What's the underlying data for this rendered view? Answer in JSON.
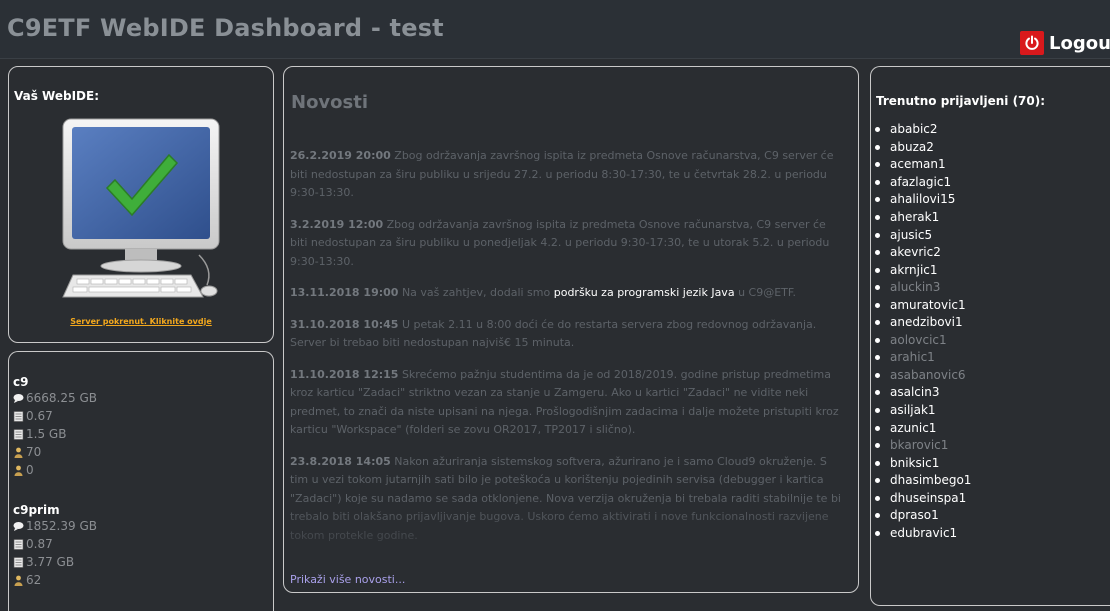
{
  "header": {
    "title": "C9ETF WebIDE Dashboard - test",
    "logout_label": "Logout",
    "logout_icon": "power-icon",
    "accent": "#d9191c"
  },
  "webide": {
    "title": "Vaš WebIDE:",
    "icon": "computer-checkmark-icon",
    "status_link": "Server pokrenut. Kliknite ovdje"
  },
  "servers": [
    {
      "name": "c9",
      "stats": [
        {
          "icon": "disk-icon",
          "value": "6668.25 GB"
        },
        {
          "icon": "cpu-icon",
          "value": "0.67"
        },
        {
          "icon": "memory-icon",
          "value": "1.5 GB"
        },
        {
          "icon": "user-icon",
          "value": "70"
        },
        {
          "icon": "user-icon",
          "value": "0"
        }
      ]
    },
    {
      "name": "c9prim",
      "stats": [
        {
          "icon": "disk-icon",
          "value": "1852.39 GB"
        },
        {
          "icon": "cpu-icon",
          "value": "0.87"
        },
        {
          "icon": "memory-icon",
          "value": "3.77 GB"
        },
        {
          "icon": "user-icon",
          "value": "62"
        }
      ]
    }
  ],
  "news": {
    "title": "Novosti",
    "more_link": "Prikaži više novosti...",
    "items": [
      {
        "date": "26.2.2019 20:00",
        "text": "Zbog održavanja završnog ispita iz predmeta Osnove računarstva, C9 server će biti nedostupan za širu publiku u srijedu 27.2. u periodu 8:30-17:30, te u četvrtak 28.2. u periodu 9:30-13:30."
      },
      {
        "date": "3.2.2019 12:00",
        "text": "Zbog održavanja završnog ispita iz predmeta Osnove računarstva, C9 server će biti nedostupan za širu publiku u ponedjeljak 4.2. u periodu 9:30-17:30, te u utorak 5.2. u periodu 9:30-13:30."
      },
      {
        "date": "13.11.2018 19:00",
        "text_before": "Na vaš zahtjev, dodali smo",
        "link": "podršku za programski jezik Java",
        "text_after": "u C9@ETF."
      },
      {
        "date": "31.10.2018 10:45",
        "text": "U petak 2.11 u 8:00 doći će do restarta servera zbog redovnog održavanja. Server bi trebao biti nedostupan najviš€ 15 minuta."
      },
      {
        "date": "11.10.2018 12:15",
        "text": "Skrećemo pažnju studentima da je od 2018/2019. godine pristup predmetima kroz karticu \"Zadaci\" striktno vezan za stanje u Zamgeru. Ako u kartici \"Zadaci\" ne vidite neki predmet, to znači da niste upisani na njega. Prošlogodišnjim zadacima i dalje možete pristupiti kroz karticu \"Workspace\" (folderi se zovu OR2017, TP2017 i slično)."
      },
      {
        "date": "23.8.2018 14:05",
        "text": "Nakon ažuriranja sistemskog softvera, ažurirano je i samo Cloud9 okruženje. S tim u vezi tokom jutarnjih sati bilo je poteškoća u korištenju pojedinih servisa (debugger i kartica \"Zadaci\") koje su nadamo se sada otklonjene. Nova verzija okruženja bi trebala raditi stabilnije te bi trebalo biti olakšano prijavljivanje bugova. Uskoro ćemo aktivirati i nove funkcionalnosti razvijene tokom protekle godine."
      }
    ]
  },
  "online": {
    "title": "Trenutno prijavljeni (70):",
    "users": [
      {
        "name": "ababic2",
        "active": true
      },
      {
        "name": "abuza2",
        "active": true
      },
      {
        "name": "aceman1",
        "active": true
      },
      {
        "name": "afazlagic1",
        "active": true
      },
      {
        "name": "ahalilovi15",
        "active": true
      },
      {
        "name": "aherak1",
        "active": true
      },
      {
        "name": "ajusic5",
        "active": true
      },
      {
        "name": "akevric2",
        "active": true
      },
      {
        "name": "akrnjic1",
        "active": true
      },
      {
        "name": "aluckin3",
        "active": false
      },
      {
        "name": "amuratovic1",
        "active": true
      },
      {
        "name": "anedzibovi1",
        "active": true
      },
      {
        "name": "aolovcic1",
        "active": false
      },
      {
        "name": "arahic1",
        "active": false
      },
      {
        "name": "asabanovic6",
        "active": false
      },
      {
        "name": "asalcin3",
        "active": true
      },
      {
        "name": "asiljak1",
        "active": true
      },
      {
        "name": "azunic1",
        "active": true
      },
      {
        "name": "bkarovic1",
        "active": false
      },
      {
        "name": "bniksic1",
        "active": true
      },
      {
        "name": "dhasimbego1",
        "active": true
      },
      {
        "name": "dhuseinspa1",
        "active": true
      },
      {
        "name": "dpraso1",
        "active": true
      },
      {
        "name": "edubravic1",
        "active": true
      }
    ]
  }
}
